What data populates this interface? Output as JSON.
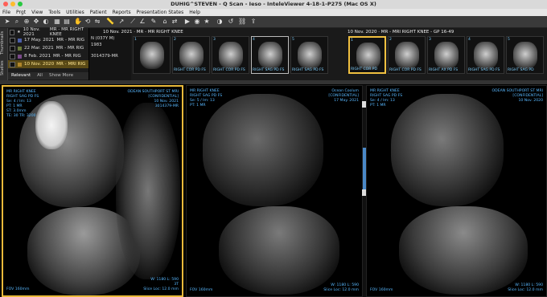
{
  "window": {
    "title": "DUHIG^STEVEN - Q Scan - Ieso - InteleViewer 4-18-1-P275 (Mac OS X)"
  },
  "menu": [
    "File",
    "Prgt",
    "View",
    "Tools",
    "Utilities",
    "Patient",
    "Reports",
    "Presentation States",
    "Help"
  ],
  "sidebar": {
    "tabs": [
      "Thumbnails",
      "Studies"
    ]
  },
  "studies": [
    {
      "date": "10 Nov. 2021",
      "desc": "MR - MR RIGHT KNEE",
      "color": "#3a6fb0"
    },
    {
      "date": "17 May. 2021",
      "desc": "MR - MR RIG",
      "color": "#4b5fa8"
    },
    {
      "date": "22 Mar. 2021",
      "desc": "MR - MR RIG",
      "color": "#6a7a3a"
    },
    {
      "date": "8 Feb. 2021",
      "desc": "MR - MR RIG",
      "color": "#7a4a8a"
    },
    {
      "date": "10 Nov. 2020",
      "desc": "MR - MRI RIG",
      "color": "#b0852a"
    }
  ],
  "filters": [
    "Relevant",
    "All",
    "Show More"
  ],
  "patient": {
    "line1": "N (037Y M)",
    "line2": "1983",
    "line3": "3014379-MR"
  },
  "series_group_a": {
    "header": "10 Nov. 2021 · MR - MR RIGHT KNEE"
  },
  "series_group_b": {
    "header": "10 Nov. 2020 · MR - MRI RIGHT KNEE - GP 16-49"
  },
  "thumbnails": [
    {
      "num": "1",
      "label": ""
    },
    {
      "num": "2",
      "label": "RIGHT COR PD FS"
    },
    {
      "num": "3",
      "label": "RIGHT COR PD FS"
    },
    {
      "num": "4",
      "label": "RIGHT SAG PD FS"
    },
    {
      "num": "5",
      "label": "RIGHT SAG PD FS"
    },
    {
      "num": "1",
      "label": "RIGHT COR PD"
    },
    {
      "num": "2",
      "label": "RIGHT COR PD FS"
    },
    {
      "num": "3",
      "label": "RIGHT AX PD FS"
    },
    {
      "num": "4",
      "label": "RIGHT SAG PD FS"
    },
    {
      "num": "5",
      "label": "RIGHT SAG PD"
    }
  ],
  "viewports": [
    {
      "tl": "MR RIGHT KNEE\nRIGHT SAG PD FS\nSe: 4 / Im: 13\nPT: 1 MR\nST: 3.0mm\nTE: 30 TR: 3200",
      "tr": "ODEAN SOUTHPORT ST MRI\n[CONFIDENTIAL]\n10 Nov. 2021\n3014379-MR",
      "br": "W: 1180 L: 590\n3T\nSlice Loc: 12.0 mm",
      "bl": "FOV 160mm"
    },
    {
      "tl": "MR RIGHT KNEE\nRIGHT SAG PD FS\nSe: 5 / Im: 13\nPT: 1 MR",
      "tr": "Ocean Coolum\n[CONFIDENTIAL]\n17 May. 2021",
      "br": "W: 1180 L: 590\nSlice Loc: 12.0 mm",
      "bl": "FOV 160mm"
    },
    {
      "tl": "MR RIGHT KNEE\nRIGHT SAG PD FS\nSe: 4 / Im: 13\nPT: 1 MR",
      "tr": "ODEAN SOUTHPORT ST MRI\n[CONFIDENTIAL]\n10 Nov. 2020",
      "br": "W: 1180 L: 590\nSlice Loc: 12.0 mm",
      "bl": "FOV 160mm"
    }
  ],
  "colors": {
    "accent": "#e9b93a",
    "overlay": "#58b8ff",
    "scroll": "#4a89c8"
  }
}
